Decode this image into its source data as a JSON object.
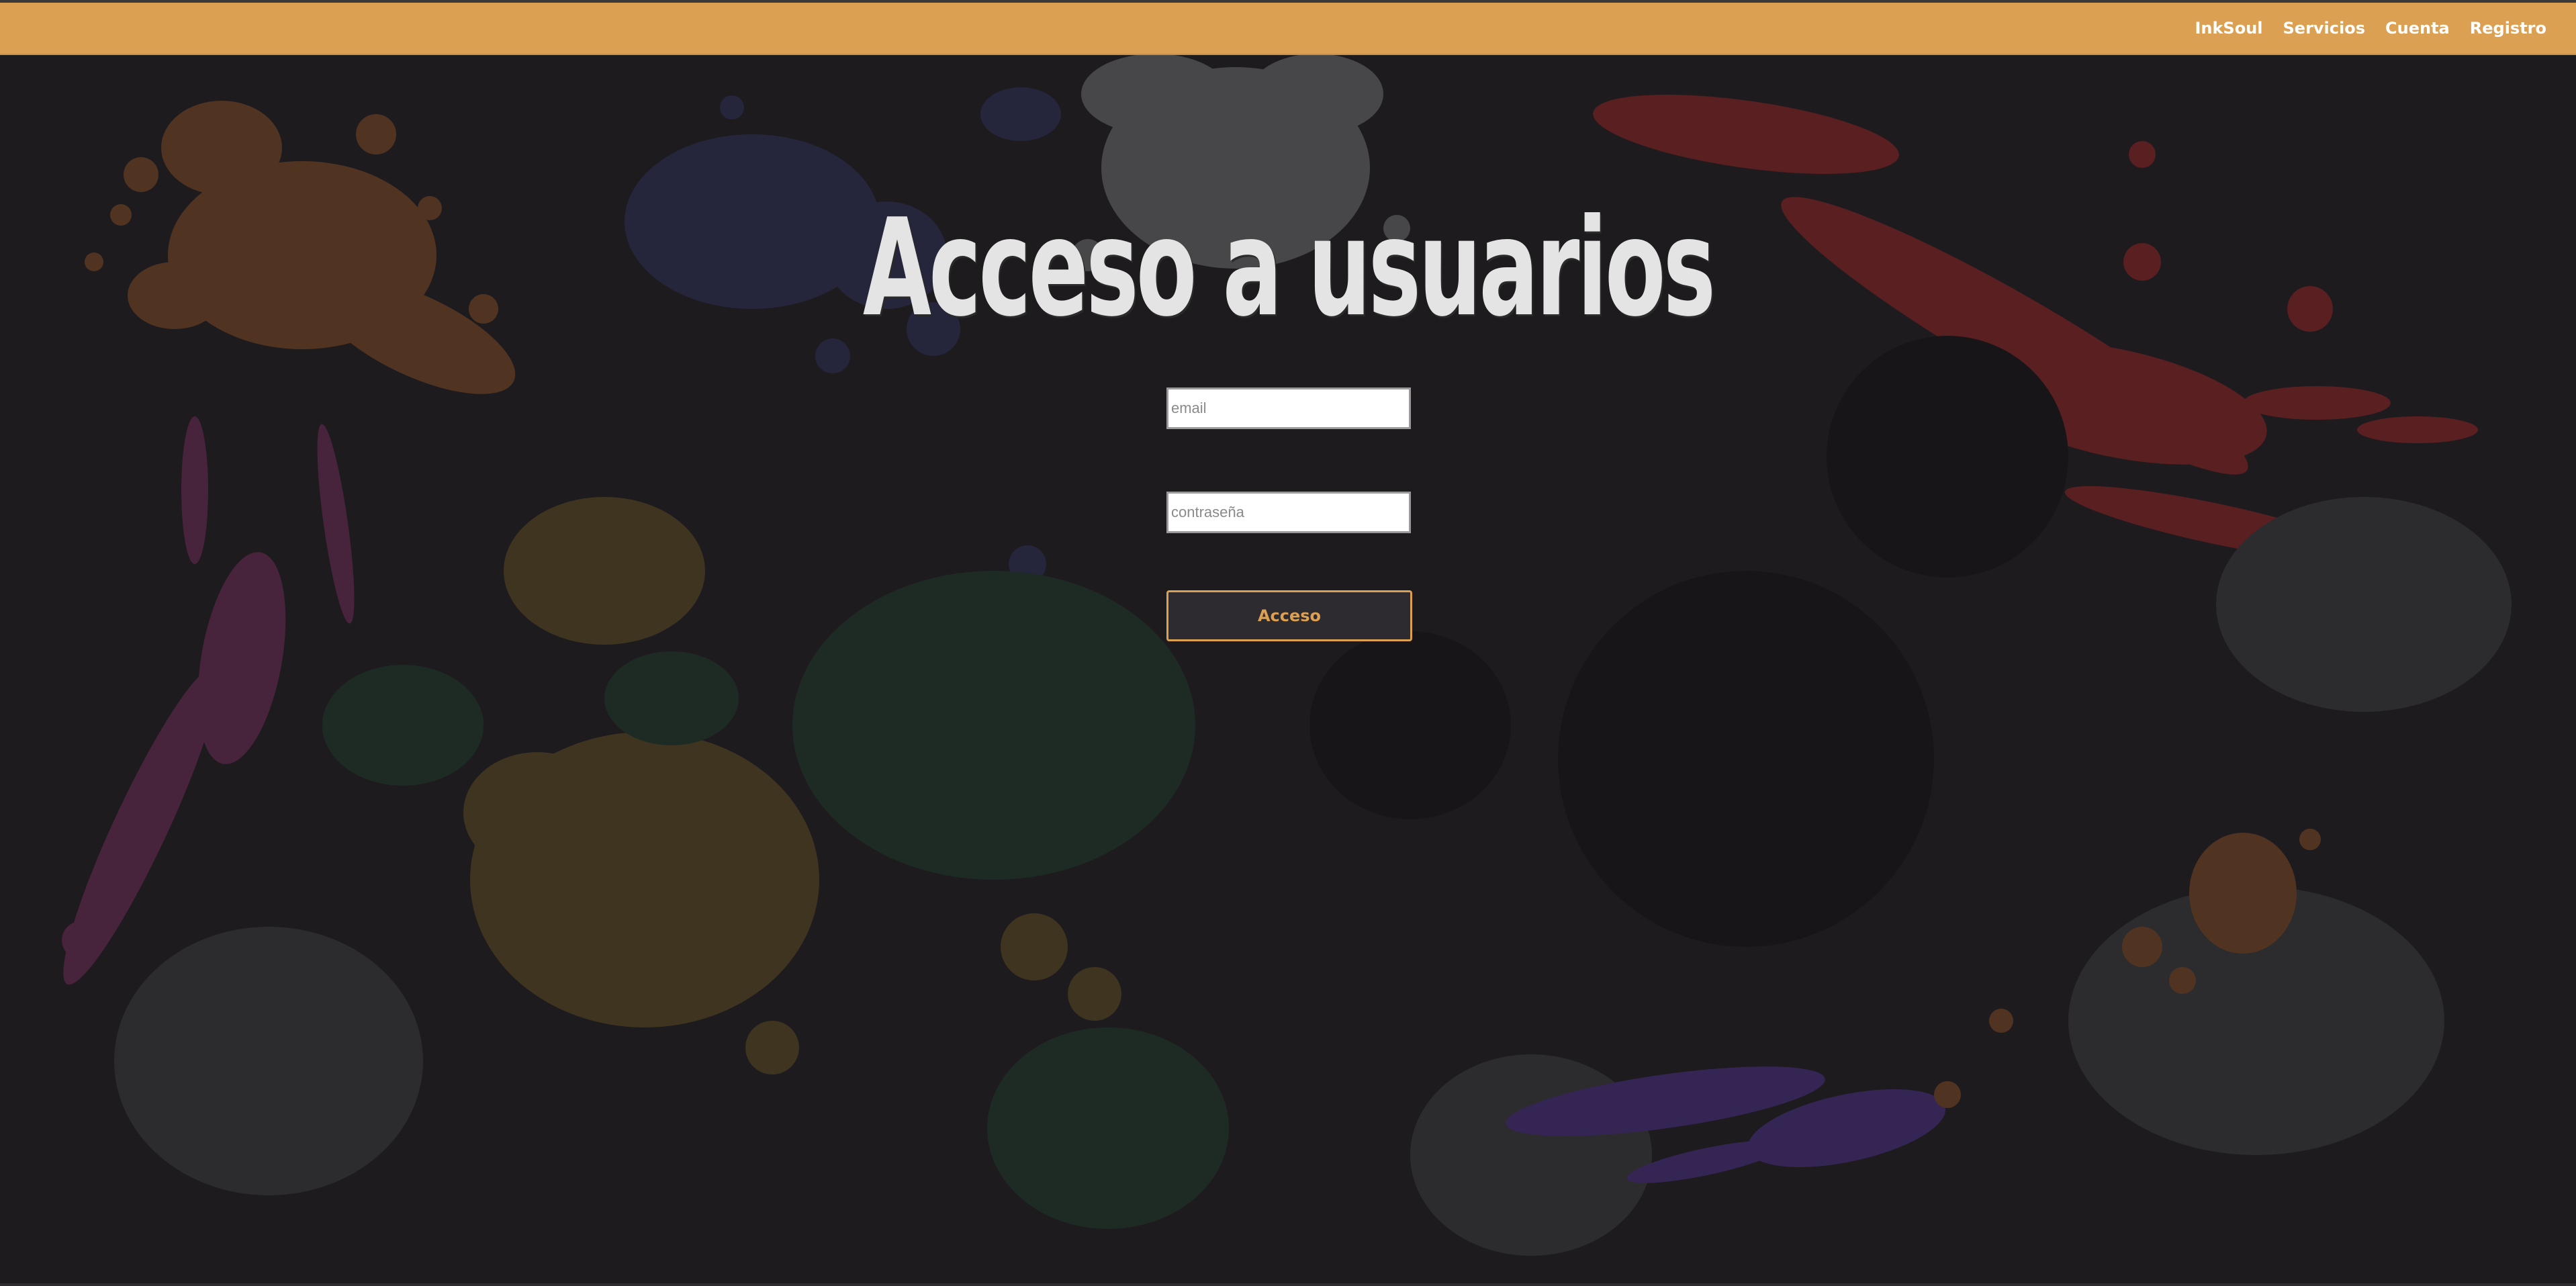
{
  "nav": {
    "items": [
      {
        "label": "InkSoul"
      },
      {
        "label": "Servicios"
      },
      {
        "label": "Cuenta"
      },
      {
        "label": "Registro"
      }
    ]
  },
  "login": {
    "title": "Acceso a usuarios",
    "email_placeholder": "email",
    "password_placeholder": "contraseña",
    "submit_label": "Acceso"
  },
  "colors": {
    "navbar": "#dba052",
    "background": "#1e1b1f",
    "accent": "#dba052",
    "title": "#e4e4e4"
  }
}
